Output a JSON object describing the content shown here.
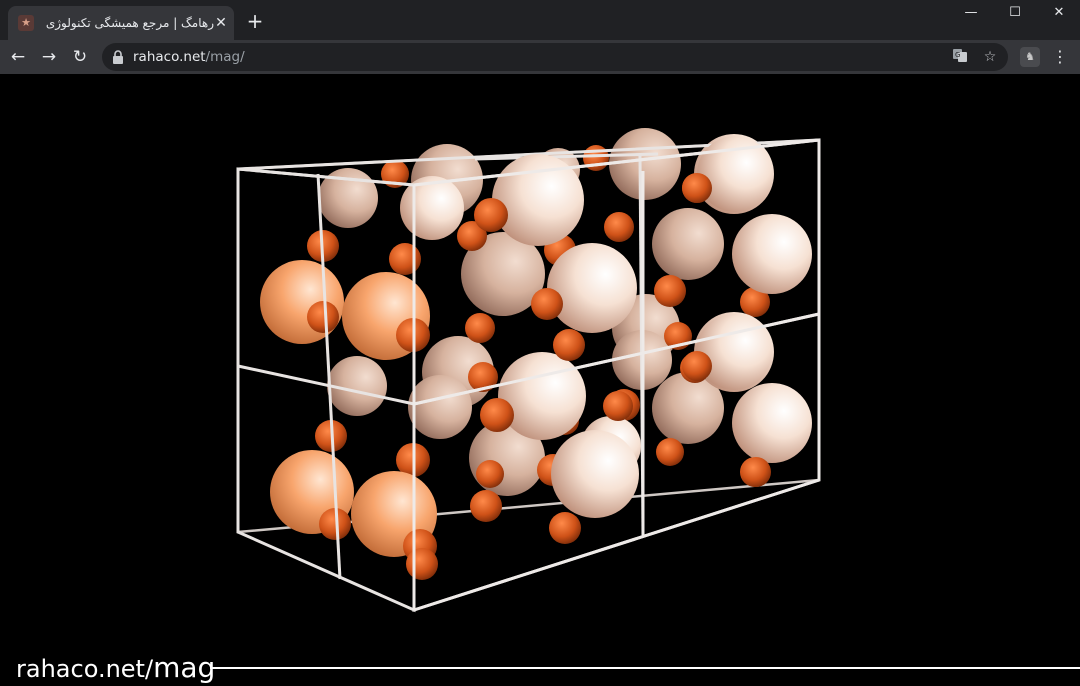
{
  "tab": {
    "title": "رهامگ | مرجع همیشگی تکنولوژی |",
    "favicon": "rahaco-favicon-icon",
    "close_glyph": "✕",
    "new_tab_glyph": "+"
  },
  "window_controls": {
    "minimize": "—",
    "maximize": "☐",
    "close": "✕"
  },
  "toolbar": {
    "back": "←",
    "forward": "→",
    "reload": "↻",
    "url_host": "rahaco.net",
    "url_path": "/mag/",
    "translate_icon": "translate-icon",
    "bookmark_glyph": "☆",
    "extension_icon": "extension-icon",
    "menu_glyph": "⋮"
  },
  "content": {
    "image": "crystal-lattice-unit-cell",
    "colors": {
      "background": "#000000",
      "large_atom": "#f3d2bd",
      "large_atom_orange": "#f59a5c",
      "small_atom": "#c9501a",
      "frame": "#e8e4e2"
    }
  },
  "footer": {
    "watermark_host": "rahaco.net/",
    "watermark_path": "mag"
  }
}
